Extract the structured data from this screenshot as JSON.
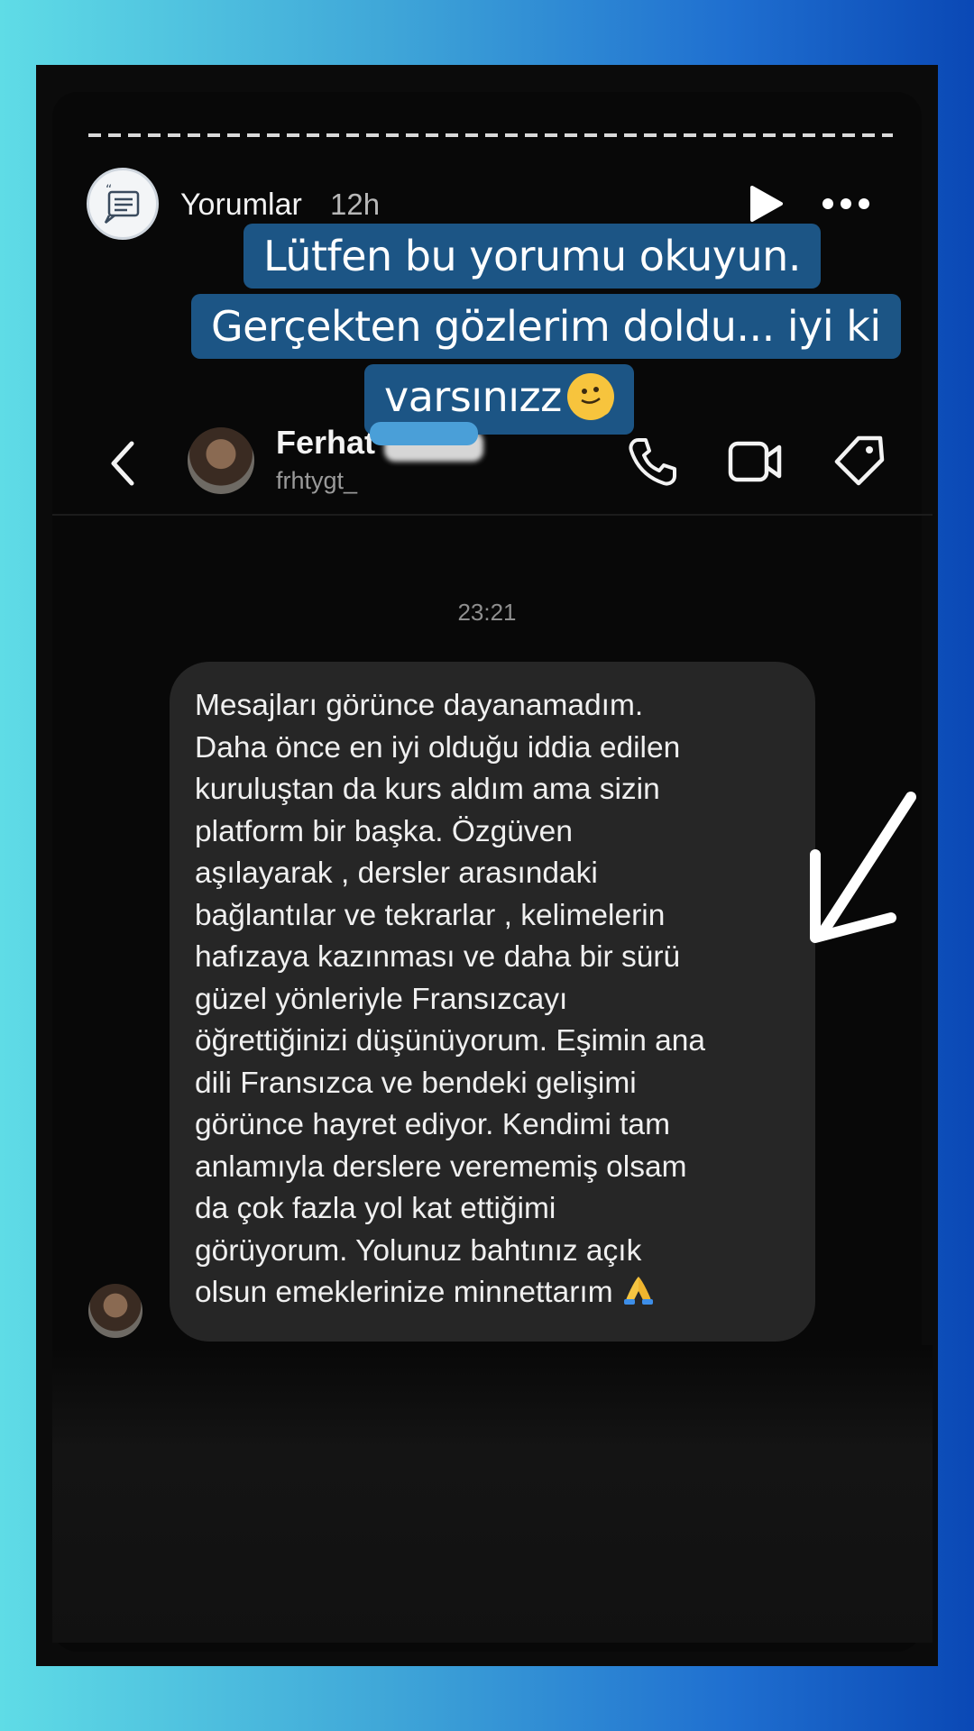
{
  "story": {
    "name": "Yorumlar",
    "time": "12h",
    "icons": [
      "quote-icon",
      "play-icon",
      "more-icon"
    ]
  },
  "caption": {
    "line1": "Lütfen bu yorumu okuyun.",
    "line2": "Gerçekten gözlerim doldu... iyi ki",
    "line3": "varsınızz",
    "emoji": "melting-face-emoji"
  },
  "dm": {
    "name": "Ferhat",
    "handle": "frhtygt_",
    "icons": [
      "back-icon",
      "call-icon",
      "video-icon",
      "tag-icon"
    ]
  },
  "conversation": {
    "timestamp": "23:21",
    "message_lines": [
      "Mesajları görünce dayanamadım.",
      "Daha önce en iyi olduğu iddia edilen",
      "kuruluştan da kurs aldım ama sizin",
      "platform bir başka. Özgüven",
      "aşılayarak , dersler arasındaki",
      "bağlantılar ve tekrarlar , kelimelerin",
      "hafızaya kazınması ve daha bir sürü",
      "güzel yönleriyle Fransızcayı",
      "öğrettiğinizi düşünüyorum. Eşimin ana",
      "dili Fransızca ve bendeki gelişimi",
      "görünce hayret ediyor. Kendimi tam",
      "anlamıyla derslere verememiş olsam",
      "da çok fazla yol kat ettiğimi",
      "görüyorum. Yolunuz bahtınız açık",
      "olsun emeklerinize minnettarım"
    ],
    "end_emoji": "folded-hands-emoji"
  },
  "colors": {
    "caption_bg": "#1c5585",
    "bubble_bg": "#262626",
    "background_gradient": [
      "#5fdce6",
      "#0a48b5"
    ]
  }
}
